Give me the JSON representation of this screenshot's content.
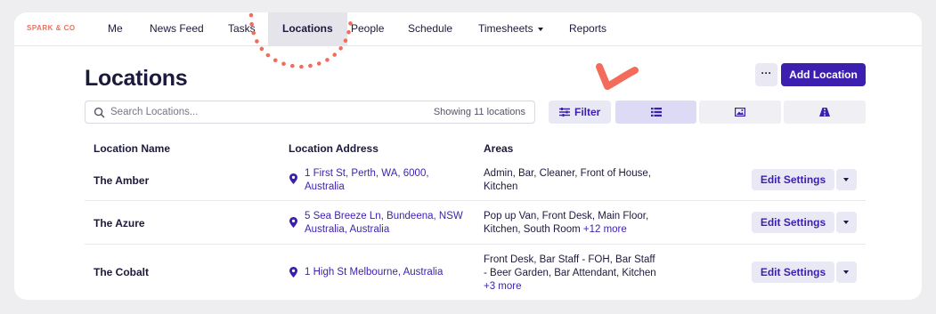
{
  "brand": "SPARK & CO",
  "nav": {
    "items": [
      {
        "label": "Me"
      },
      {
        "label": "News Feed"
      },
      {
        "label": "Tasks"
      },
      {
        "label": "Locations",
        "active": true
      },
      {
        "label": "People"
      },
      {
        "label": "Schedule"
      },
      {
        "label": "Timesheets",
        "dropdown": true
      },
      {
        "label": "Reports"
      }
    ]
  },
  "page": {
    "title": "Locations",
    "more_label": "···",
    "add_label": "Add Location"
  },
  "search": {
    "placeholder": "Search Locations...",
    "value": "",
    "count_text": "Showing 11 locations"
  },
  "filter_label": "Filter",
  "views": [
    {
      "icon": "list-icon",
      "active": true
    },
    {
      "icon": "image-icon",
      "active": false
    },
    {
      "icon": "map-road-icon",
      "active": false
    }
  ],
  "table": {
    "headers": [
      "Location Name",
      "Location Address",
      "Areas"
    ],
    "rows": [
      {
        "name": "The Amber",
        "address_lines": [
          "1 First St, Perth, WA, 6000,",
          "Australia"
        ],
        "areas_lines": [
          "Admin, Bar, Cleaner, Front of House,",
          "Kitchen"
        ],
        "more": "",
        "edit_label": "Edit Settings"
      },
      {
        "name": "The Azure",
        "address_lines": [
          "5 Sea Breeze Ln, Bundeena, NSW",
          "Australia, Australia"
        ],
        "areas_lines": [
          "Pop up Van, Front Desk, Main Floor,",
          "Kitchen, South Room"
        ],
        "more": "+12 more",
        "edit_label": "Edit Settings"
      },
      {
        "name": "The Cobalt",
        "address_lines": [
          "1 High St Melbourne, Australia"
        ],
        "areas_lines": [
          "Front Desk, Bar Staff - FOH, Bar Staff",
          "- Beer Garden, Bar Attendant, Kitchen"
        ],
        "more": "+3 more",
        "edit_label": "Edit Settings"
      }
    ]
  },
  "colors": {
    "accent": "#3d1fb0",
    "annotation": "#f26b5b",
    "brand": "#e9725f"
  }
}
